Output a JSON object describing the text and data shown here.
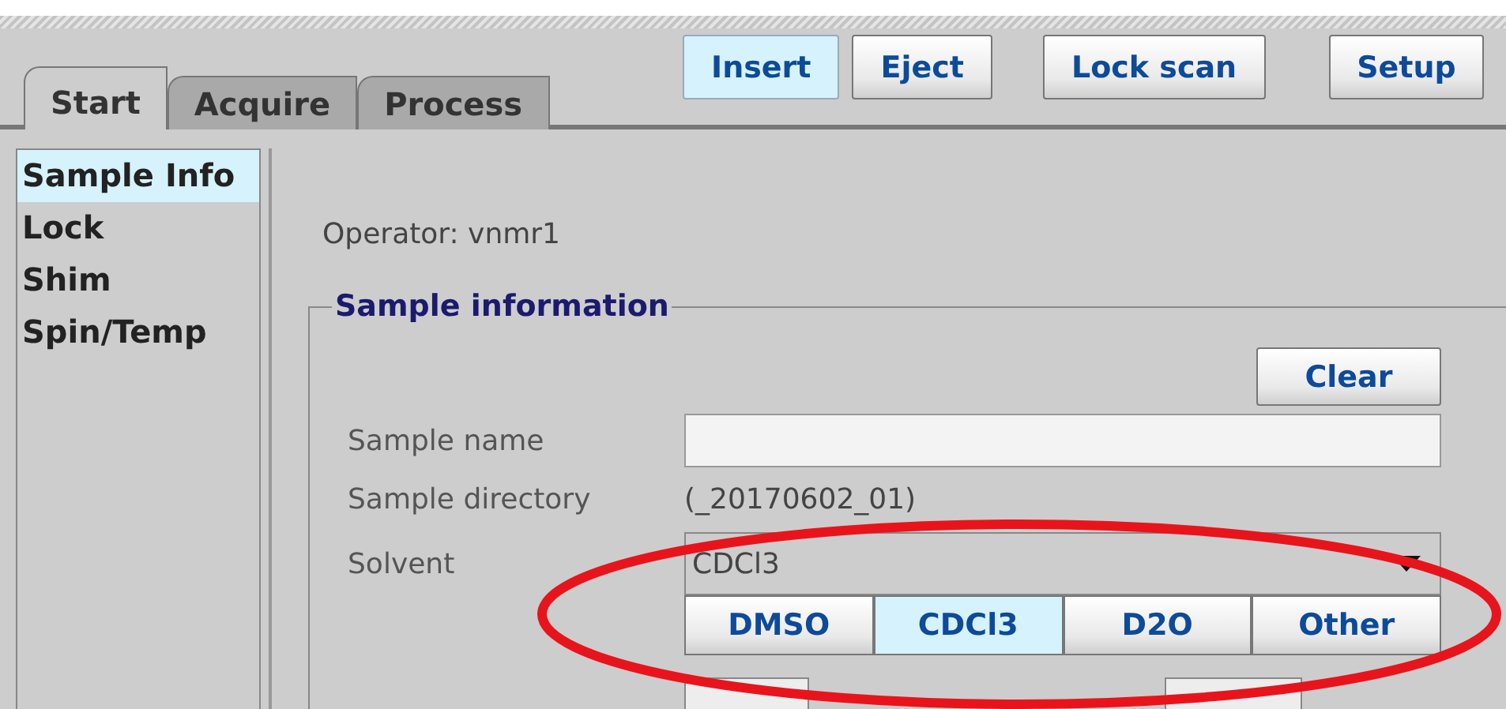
{
  "tabs": [
    {
      "label": "Start",
      "selected": true
    },
    {
      "label": "Acquire",
      "selected": false
    },
    {
      "label": "Process",
      "selected": false
    }
  ],
  "toolbar_buttons": [
    {
      "label": "Insert",
      "selected": true
    },
    {
      "label": "Eject",
      "selected": false
    },
    {
      "label": "Lock scan",
      "selected": false
    },
    {
      "label": "Setup",
      "selected": false
    }
  ],
  "sidebar": {
    "items": [
      {
        "label": "Sample Info",
        "selected": true
      },
      {
        "label": "Lock",
        "selected": false
      },
      {
        "label": "Shim",
        "selected": false
      },
      {
        "label": "Spin/Temp",
        "selected": false
      }
    ]
  },
  "operator": "Operator: vnmr1",
  "sample_information": {
    "title": "Sample information",
    "clear_button": "Clear",
    "fields": [
      {
        "kind": "input",
        "label": "Sample name"
      },
      {
        "kind": "text",
        "label": "Sample directory",
        "value": "(_20170602_01)"
      },
      {
        "kind": "dropdown",
        "label": "Solvent",
        "value": "CDCl3"
      }
    ],
    "solvent_buttons": [
      {
        "label": "DMSO",
        "selected": false
      },
      {
        "label": "CDCl3",
        "selected": true
      },
      {
        "label": "D2O",
        "selected": false
      },
      {
        "label": "Other",
        "selected": false
      }
    ]
  }
}
